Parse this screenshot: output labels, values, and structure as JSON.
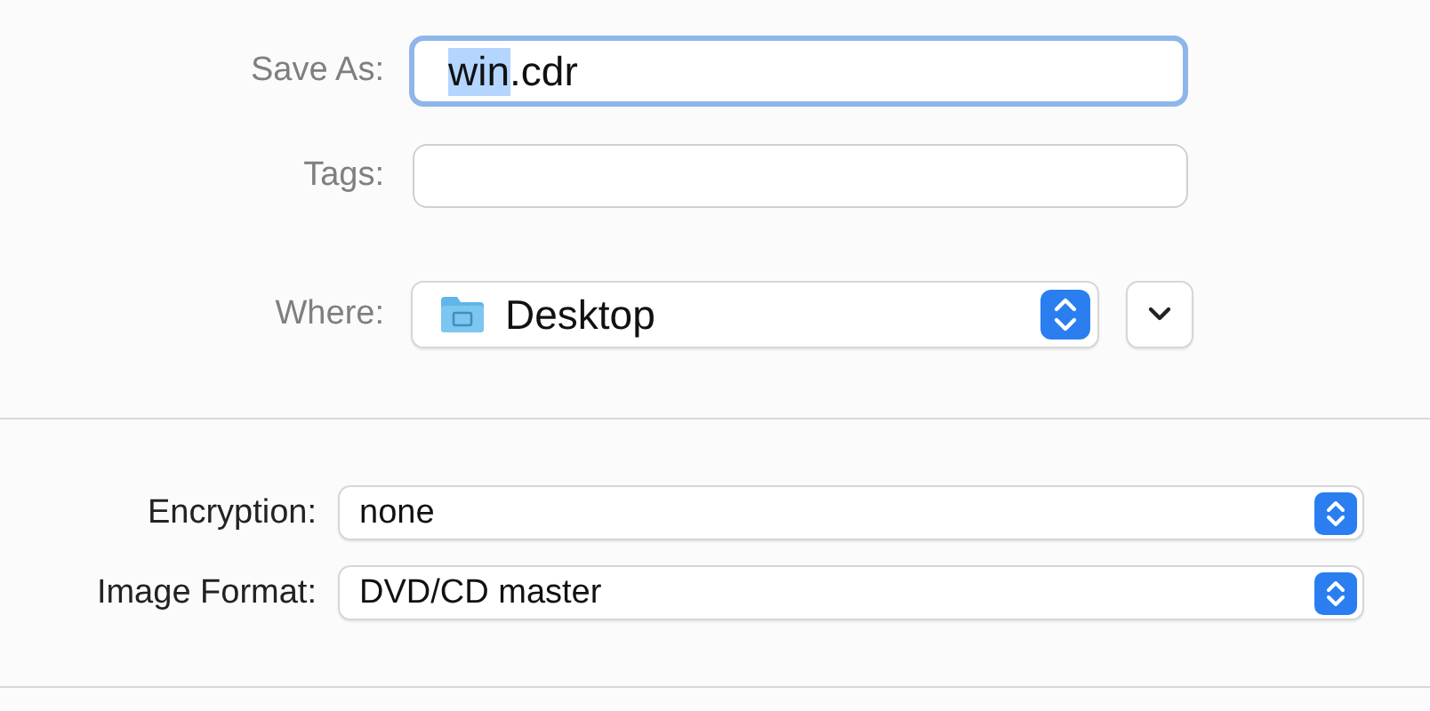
{
  "save_as": {
    "label": "Save As:",
    "focused": true,
    "value": [
      {
        "text": "win",
        "selected": true
      },
      {
        "text": ".cdr",
        "selected": false
      }
    ]
  },
  "tags": {
    "label": "Tags:"
  },
  "where": {
    "label": "Where:",
    "value": "Desktop"
  },
  "options": [
    {
      "label": "Encryption:",
      "value": "none"
    },
    {
      "label": "Image Format:",
      "value": "DVD/CD master"
    }
  ]
}
